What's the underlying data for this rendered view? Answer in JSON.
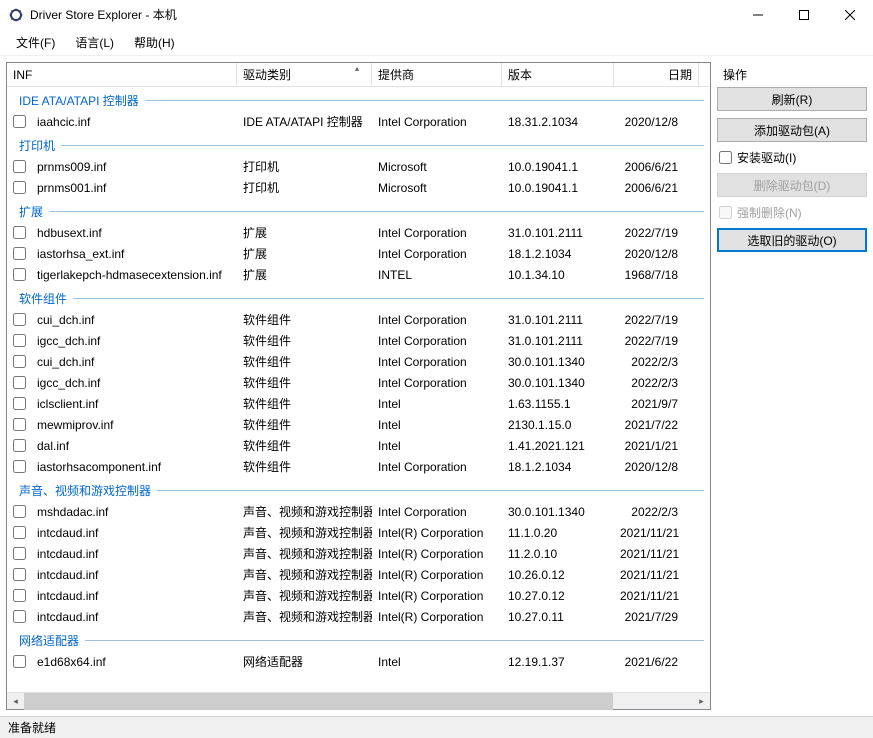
{
  "window": {
    "title": "Driver Store Explorer - 本机"
  },
  "menu": {
    "file": "文件(F)",
    "language": "语言(L)",
    "help": "帮助(H)"
  },
  "columns": {
    "inf": "INF",
    "category": "驱动类别",
    "provider": "提供商",
    "version": "版本",
    "date": "日期"
  },
  "groups": [
    {
      "name": "IDE ATA/ATAPI 控制器",
      "rows": [
        {
          "inf": "iaahcic.inf",
          "cat": "IDE ATA/ATAPI 控制器",
          "prov": "Intel Corporation",
          "ver": "18.31.2.1034",
          "date": "2020/12/8"
        }
      ]
    },
    {
      "name": "打印机",
      "rows": [
        {
          "inf": "prnms009.inf",
          "cat": "打印机",
          "prov": "Microsoft",
          "ver": "10.0.19041.1",
          "date": "2006/6/21"
        },
        {
          "inf": "prnms001.inf",
          "cat": "打印机",
          "prov": "Microsoft",
          "ver": "10.0.19041.1",
          "date": "2006/6/21"
        }
      ]
    },
    {
      "name": "扩展",
      "rows": [
        {
          "inf": "hdbusext.inf",
          "cat": "扩展",
          "prov": "Intel Corporation",
          "ver": "31.0.101.2111",
          "date": "2022/7/19"
        },
        {
          "inf": "iastorhsa_ext.inf",
          "cat": "扩展",
          "prov": "Intel Corporation",
          "ver": "18.1.2.1034",
          "date": "2020/12/8"
        },
        {
          "inf": "tigerlakepch-hdmasecextension.inf",
          "cat": "扩展",
          "prov": "INTEL",
          "ver": "10.1.34.10",
          "date": "1968/7/18"
        }
      ]
    },
    {
      "name": "软件组件",
      "rows": [
        {
          "inf": "cui_dch.inf",
          "cat": "软件组件",
          "prov": "Intel Corporation",
          "ver": "31.0.101.2111",
          "date": "2022/7/19"
        },
        {
          "inf": "igcc_dch.inf",
          "cat": "软件组件",
          "prov": "Intel Corporation",
          "ver": "31.0.101.2111",
          "date": "2022/7/19"
        },
        {
          "inf": "cui_dch.inf",
          "cat": "软件组件",
          "prov": "Intel Corporation",
          "ver": "30.0.101.1340",
          "date": "2022/2/3"
        },
        {
          "inf": "igcc_dch.inf",
          "cat": "软件组件",
          "prov": "Intel Corporation",
          "ver": "30.0.101.1340",
          "date": "2022/2/3"
        },
        {
          "inf": "iclsclient.inf",
          "cat": "软件组件",
          "prov": "Intel",
          "ver": "1.63.1155.1",
          "date": "2021/9/7"
        },
        {
          "inf": "mewmiprov.inf",
          "cat": "软件组件",
          "prov": "Intel",
          "ver": "2130.1.15.0",
          "date": "2021/7/22"
        },
        {
          "inf": "dal.inf",
          "cat": "软件组件",
          "prov": "Intel",
          "ver": "1.41.2021.121",
          "date": "2021/1/21"
        },
        {
          "inf": "iastorhsacomponent.inf",
          "cat": "软件组件",
          "prov": "Intel Corporation",
          "ver": "18.1.2.1034",
          "date": "2020/12/8"
        }
      ]
    },
    {
      "name": "声音、视频和游戏控制器",
      "rows": [
        {
          "inf": "mshdadac.inf",
          "cat": "声音、视频和游戏控制器",
          "prov": "Intel Corporation",
          "ver": "30.0.101.1340",
          "date": "2022/2/3"
        },
        {
          "inf": "intcdaud.inf",
          "cat": "声音、视频和游戏控制器",
          "prov": "Intel(R) Corporation",
          "ver": "11.1.0.20",
          "date": "2021/11/21"
        },
        {
          "inf": "intcdaud.inf",
          "cat": "声音、视频和游戏控制器",
          "prov": "Intel(R) Corporation",
          "ver": "11.2.0.10",
          "date": "2021/11/21"
        },
        {
          "inf": "intcdaud.inf",
          "cat": "声音、视频和游戏控制器",
          "prov": "Intel(R) Corporation",
          "ver": "10.26.0.12",
          "date": "2021/11/21"
        },
        {
          "inf": "intcdaud.inf",
          "cat": "声音、视频和游戏控制器",
          "prov": "Intel(R) Corporation",
          "ver": "10.27.0.12",
          "date": "2021/11/21"
        },
        {
          "inf": "intcdaud.inf",
          "cat": "声音、视频和游戏控制器",
          "prov": "Intel(R) Corporation",
          "ver": "10.27.0.11",
          "date": "2021/7/29"
        }
      ]
    },
    {
      "name": "网络适配器",
      "rows": [
        {
          "inf": "e1d68x64.inf",
          "cat": "网络适配器",
          "prov": "Intel",
          "ver": "12.19.1.37",
          "date": "2021/6/22"
        }
      ]
    }
  ],
  "actions": {
    "title": "操作",
    "refresh": "刷新(R)",
    "add": "添加驱动包(A)",
    "install": "安装驱动(I)",
    "delete": "删除驱动包(D)",
    "force": "强制删除(N)",
    "selectOld": "选取旧的驱动(O)"
  },
  "status": "准备就绪"
}
